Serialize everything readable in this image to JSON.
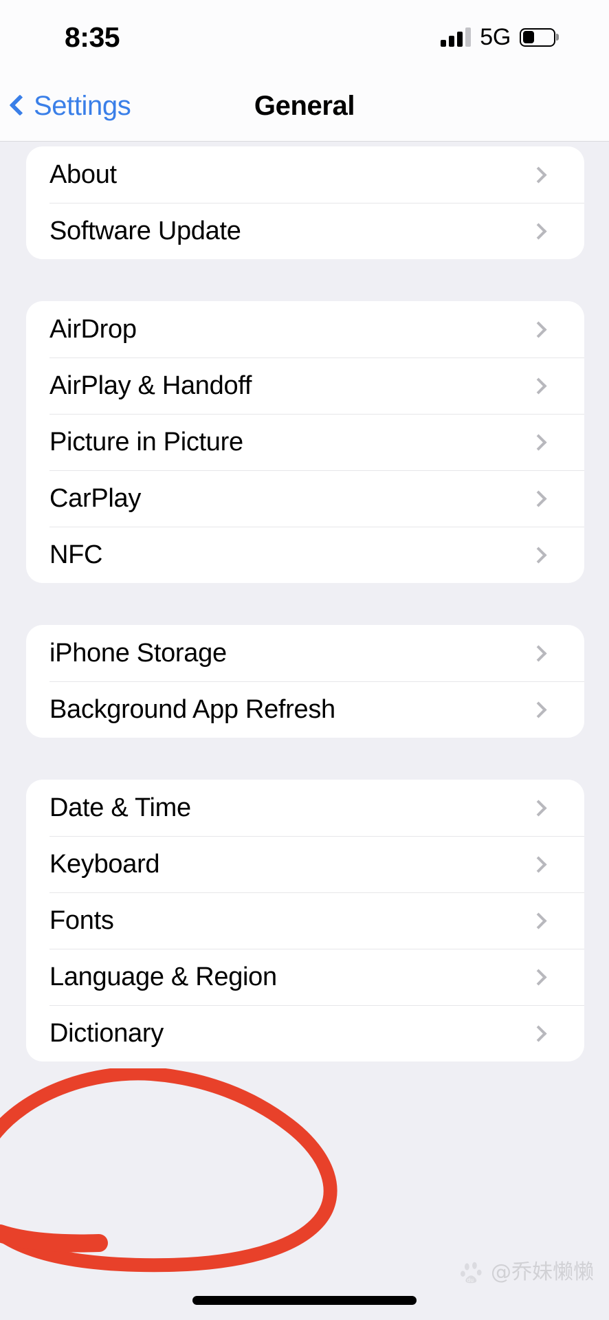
{
  "status_bar": {
    "time": "8:35",
    "network": "5G",
    "signal_bars_total": 4,
    "signal_bars_active": 3,
    "battery_percent": 38
  },
  "nav": {
    "back_label": "Settings",
    "title": "General"
  },
  "sections": [
    {
      "id": "system-info",
      "rows": [
        {
          "label": "About"
        },
        {
          "label": "Software Update"
        }
      ]
    },
    {
      "id": "connectivity",
      "rows": [
        {
          "label": "AirDrop"
        },
        {
          "label": "AirPlay & Handoff"
        },
        {
          "label": "Picture in Picture"
        },
        {
          "label": "CarPlay"
        },
        {
          "label": "NFC"
        }
      ]
    },
    {
      "id": "storage",
      "rows": [
        {
          "label": "iPhone Storage"
        },
        {
          "label": "Background App Refresh"
        }
      ]
    },
    {
      "id": "localization",
      "rows": [
        {
          "label": "Date & Time"
        },
        {
          "label": "Keyboard"
        },
        {
          "label": "Fonts"
        },
        {
          "label": "Language & Region"
        },
        {
          "label": "Dictionary"
        }
      ]
    }
  ],
  "annotation": {
    "kind": "hand-drawn-circle",
    "target_label": "Language & Region",
    "color": "#e8412a"
  },
  "watermark": {
    "text": "@乔妹懒懒",
    "logo_label": "du"
  },
  "colors": {
    "page_background": "#efeff4",
    "card_background": "#ffffff",
    "bar_background": "#fcfcfd",
    "accent_blue": "#3a7fe8",
    "divider": "#e6e6e9",
    "chevron_gray": "#b8b8bd",
    "annotation_red": "#e8412a"
  }
}
